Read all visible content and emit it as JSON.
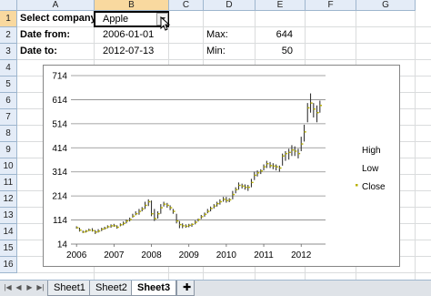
{
  "columns": [
    "A",
    "B",
    "C",
    "D",
    "E",
    "F",
    "G"
  ],
  "rows": [
    "1",
    "2",
    "3",
    "4",
    "5",
    "6",
    "7",
    "8",
    "9",
    "10",
    "11",
    "12",
    "13",
    "14",
    "15",
    "16"
  ],
  "cells": {
    "a1": "Select company:",
    "b1": "Apple",
    "a2": "Date from:",
    "b2": "2006-01-01",
    "d2": "Max:",
    "e2": "644",
    "a3": "Date to:",
    "b3": "2012-07-13",
    "d3": "Min:",
    "e3": "50"
  },
  "sheet_tabs": [
    "Sheet1",
    "Sheet2",
    "Sheet3"
  ],
  "active_tab": "Sheet3",
  "chart_data": {
    "type": "stock-hlc",
    "ylim": [
      14,
      714
    ],
    "yticks": [
      14,
      114,
      214,
      314,
      414,
      514,
      614,
      714
    ],
    "xticks": [
      "2006",
      "2007",
      "2008",
      "2009",
      "2010",
      "2011",
      "2012"
    ],
    "legend": [
      "High",
      "Low",
      "Close"
    ],
    "legend_position": "right",
    "color": "#333333",
    "close_color": "#b8b000",
    "series": {
      "x": [
        2006.0,
        2006.08,
        2006.17,
        2006.25,
        2006.33,
        2006.42,
        2006.5,
        2006.58,
        2006.67,
        2006.75,
        2006.83,
        2006.92,
        2007.0,
        2007.08,
        2007.17,
        2007.25,
        2007.33,
        2007.42,
        2007.5,
        2007.58,
        2007.67,
        2007.75,
        2007.83,
        2007.92,
        2008.0,
        2008.08,
        2008.17,
        2008.25,
        2008.33,
        2008.42,
        2008.5,
        2008.58,
        2008.67,
        2008.75,
        2008.83,
        2008.92,
        2009.0,
        2009.08,
        2009.17,
        2009.25,
        2009.33,
        2009.42,
        2009.5,
        2009.58,
        2009.67,
        2009.75,
        2009.83,
        2009.92,
        2010.0,
        2010.08,
        2010.17,
        2010.25,
        2010.33,
        2010.42,
        2010.5,
        2010.58,
        2010.67,
        2010.75,
        2010.83,
        2010.92,
        2011.0,
        2011.08,
        2011.17,
        2011.25,
        2011.33,
        2011.42,
        2011.5,
        2011.58,
        2011.67,
        2011.75,
        2011.83,
        2011.92,
        2012.0,
        2012.08,
        2012.17,
        2012.25,
        2012.33,
        2012.42,
        2012.5
      ],
      "high": [
        88,
        82,
        70,
        72,
        78,
        80,
        72,
        76,
        82,
        86,
        92,
        96,
        98,
        92,
        100,
        108,
        116,
        124,
        140,
        150,
        160,
        168,
        190,
        200,
        195,
        160,
        150,
        180,
        190,
        185,
        175,
        160,
        140,
        110,
        100,
        96,
        98,
        100,
        112,
        120,
        135,
        145,
        160,
        170,
        180,
        190,
        200,
        210,
        210,
        205,
        235,
        250,
        270,
        265,
        262,
        260,
        285,
        315,
        320,
        325,
        345,
        360,
        355,
        350,
        345,
        340,
        390,
        400,
        410,
        425,
        420,
        410,
        460,
        510,
        600,
        640,
        600,
        590,
        610
      ],
      "low": [
        78,
        66,
        60,
        62,
        68,
        66,
        56,
        62,
        68,
        74,
        80,
        82,
        86,
        78,
        88,
        92,
        100,
        108,
        124,
        134,
        136,
        150,
        160,
        172,
        130,
        110,
        120,
        140,
        170,
        165,
        155,
        140,
        100,
        80,
        80,
        82,
        84,
        86,
        96,
        108,
        118,
        128,
        142,
        150,
        162,
        170,
        178,
        190,
        186,
        188,
        200,
        225,
        240,
        245,
        240,
        235,
        250,
        280,
        295,
        305,
        320,
        330,
        330,
        325,
        320,
        315,
        340,
        360,
        365,
        380,
        380,
        370,
        400,
        440,
        520,
        560,
        540,
        520,
        560
      ],
      "close": [
        82,
        72,
        64,
        68,
        72,
        70,
        64,
        68,
        76,
        80,
        86,
        90,
        90,
        84,
        94,
        100,
        110,
        116,
        130,
        140,
        150,
        160,
        175,
        190,
        140,
        120,
        140,
        165,
        180,
        175,
        165,
        150,
        110,
        95,
        90,
        88,
        92,
        96,
        105,
        115,
        128,
        138,
        150,
        162,
        172,
        182,
        190,
        200,
        195,
        198,
        220,
        240,
        258,
        255,
        250,
        250,
        270,
        300,
        310,
        318,
        335,
        348,
        340,
        338,
        335,
        330,
        380,
        390,
        395,
        405,
        400,
        390,
        430,
        480,
        580,
        600,
        575,
        560,
        590
      ]
    }
  }
}
